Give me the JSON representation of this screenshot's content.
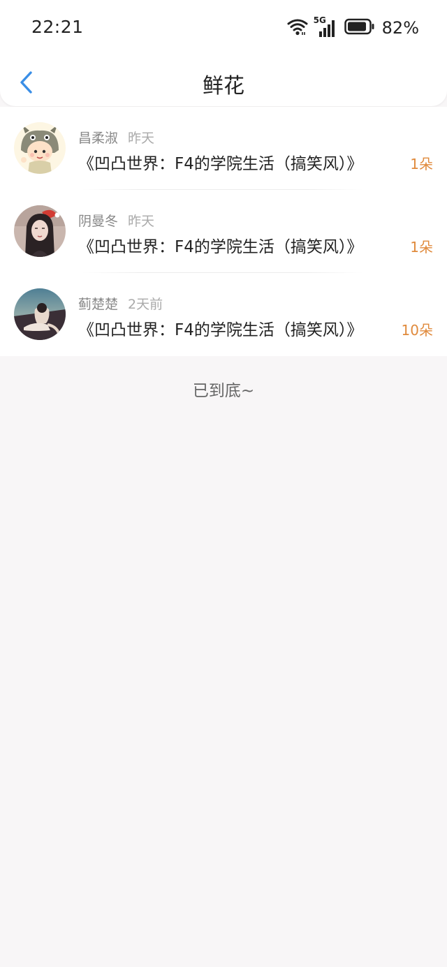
{
  "status_bar": {
    "time": "22:21",
    "network": "5G",
    "battery_percent": "82%",
    "icons": [
      "wifi-icon",
      "signal-icon",
      "battery-icon"
    ]
  },
  "header": {
    "title": "鲜花",
    "back_icon": "chevron-left-icon"
  },
  "flowers": [
    {
      "name": "昌柔淑",
      "time": "昨天",
      "book": "《凹凸世界：F4的学院生活（搞笑风）》",
      "count": "1朵"
    },
    {
      "name": "阴曼冬",
      "time": "昨天",
      "book": "《凹凸世界：F4的学院生活（搞笑风）》",
      "count": "1朵"
    },
    {
      "name": "蓟楚楚",
      "time": "2天前",
      "book": "《凹凸世界：F4的学院生活（搞笑风）》",
      "count": "10朵"
    }
  ],
  "footer": {
    "end_text": "已到底~"
  },
  "colors": {
    "accent_blue": "#3a8ee6",
    "flower_count": "#e08a3c",
    "background": "#f8f6f7"
  }
}
